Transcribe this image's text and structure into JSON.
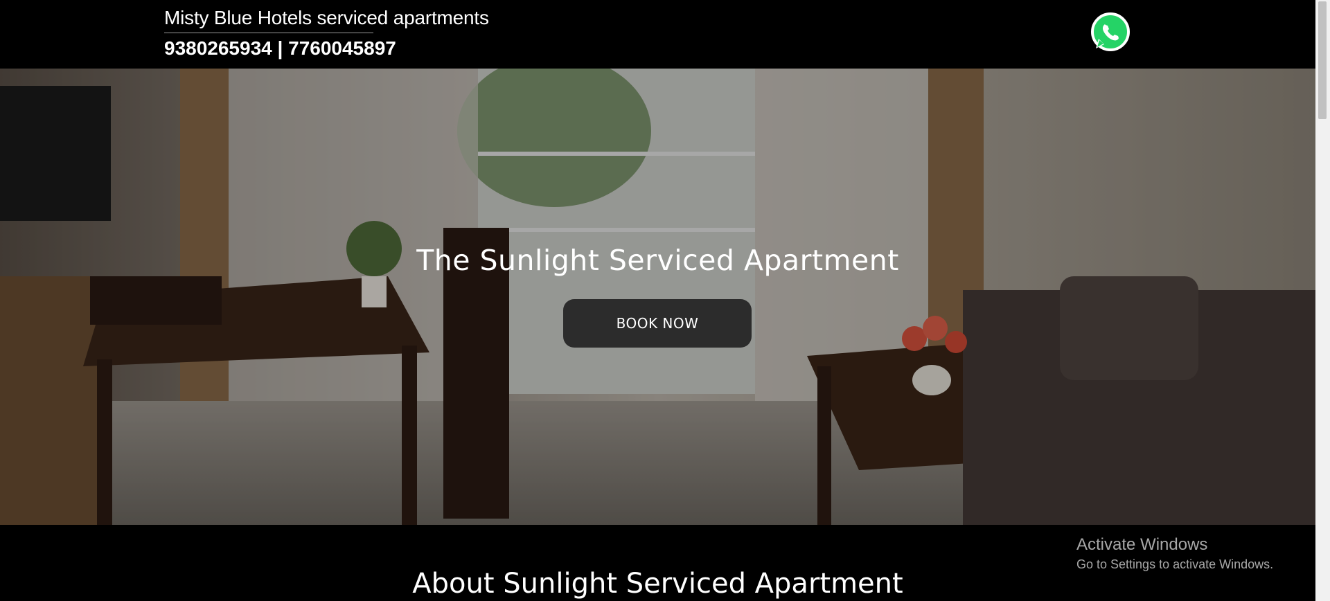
{
  "header": {
    "brand": "Misty Blue Hotels serviced apartments",
    "phones": "9380265934 | 7760045897",
    "whatsapp_icon": "whatsapp-icon"
  },
  "hero": {
    "title": "The Sunlight Serviced Apartment",
    "cta": "BOOK NOW"
  },
  "about": {
    "title": "About Sunlight Serviced Apartment"
  },
  "watermark": {
    "line1": "Activate Windows",
    "line2": "Go to Settings to activate Windows."
  },
  "colors": {
    "whatsapp_green": "#25D366",
    "button_bg": "#2c2c2c"
  }
}
